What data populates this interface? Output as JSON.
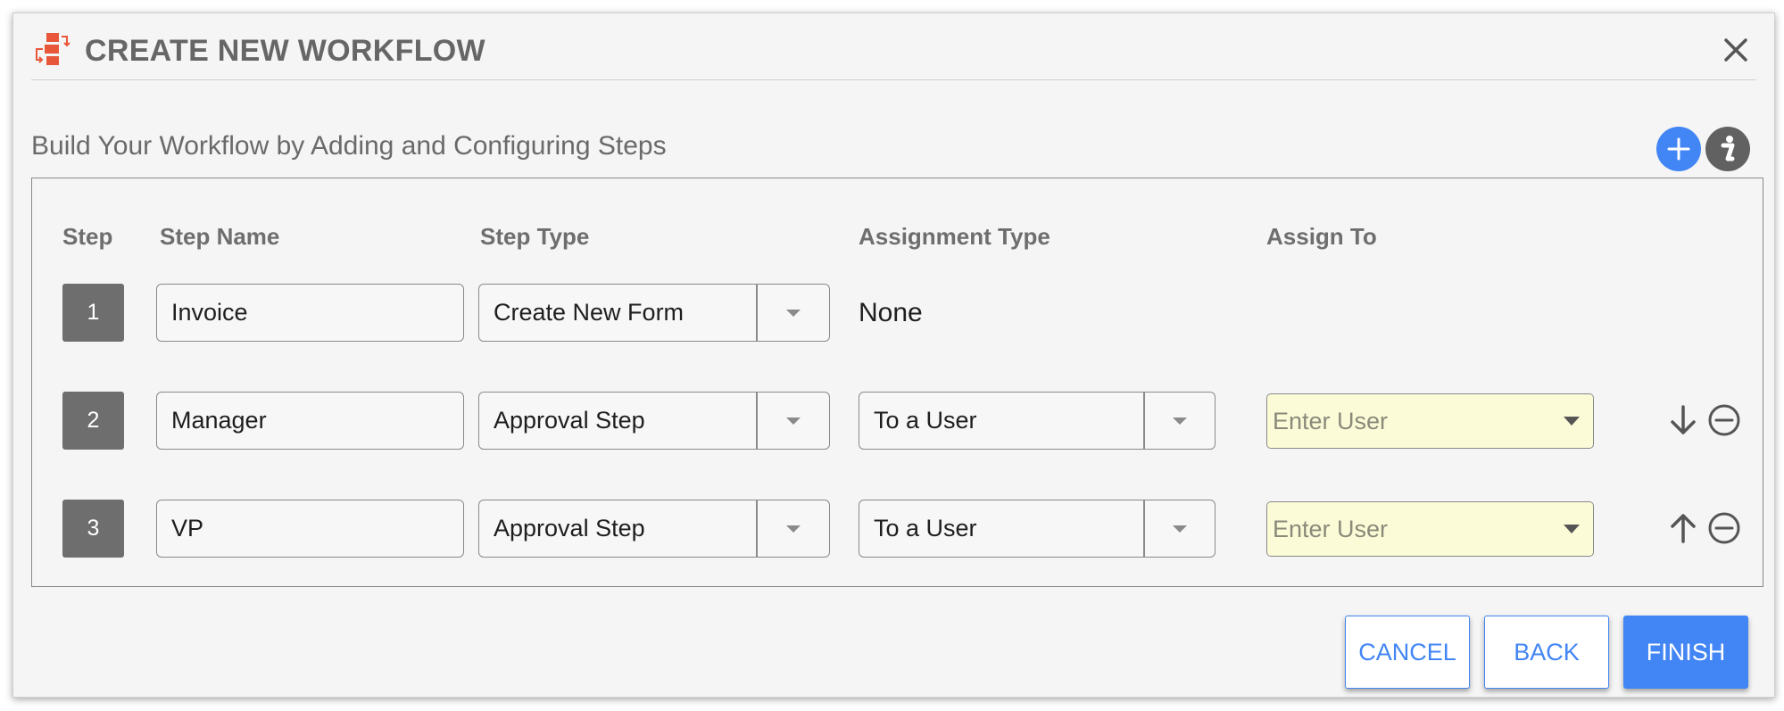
{
  "dialog": {
    "title": "CREATE NEW WORKFLOW",
    "subtitle": "Build Your Workflow by Adding and Configuring Steps",
    "icons": {
      "title": "workflow-icon",
      "close": "close-icon",
      "add": "plus-icon",
      "info": "info-icon"
    }
  },
  "table": {
    "headers": {
      "step": "Step",
      "step_name": "Step Name",
      "step_type": "Step Type",
      "assignment_type": "Assignment Type",
      "assign_to": "Assign To"
    },
    "rows": [
      {
        "number": "1",
        "name": "Invoice",
        "step_type": "Create New Form",
        "assignment_type": "None"
      },
      {
        "number": "2",
        "name": "Manager",
        "step_type": "Approval Step",
        "assignment_type": "To a User",
        "assign_to_placeholder": "Enter User",
        "move_icon": "arrow-down-icon",
        "remove_icon": "minus-circle-icon"
      },
      {
        "number": "3",
        "name": "VP",
        "step_type": "Approval Step",
        "assignment_type": "To a User",
        "assign_to_placeholder": "Enter User",
        "move_icon": "arrow-up-icon",
        "remove_icon": "minus-circle-icon"
      }
    ]
  },
  "footer": {
    "cancel": "CANCEL",
    "back": "BACK",
    "finish": "FINISH"
  },
  "colors": {
    "accent": "#4285f4",
    "title_icon": "#e8573a",
    "assign_field_bg": "#fbfbd7",
    "step_badge": "#6e6e6e"
  }
}
